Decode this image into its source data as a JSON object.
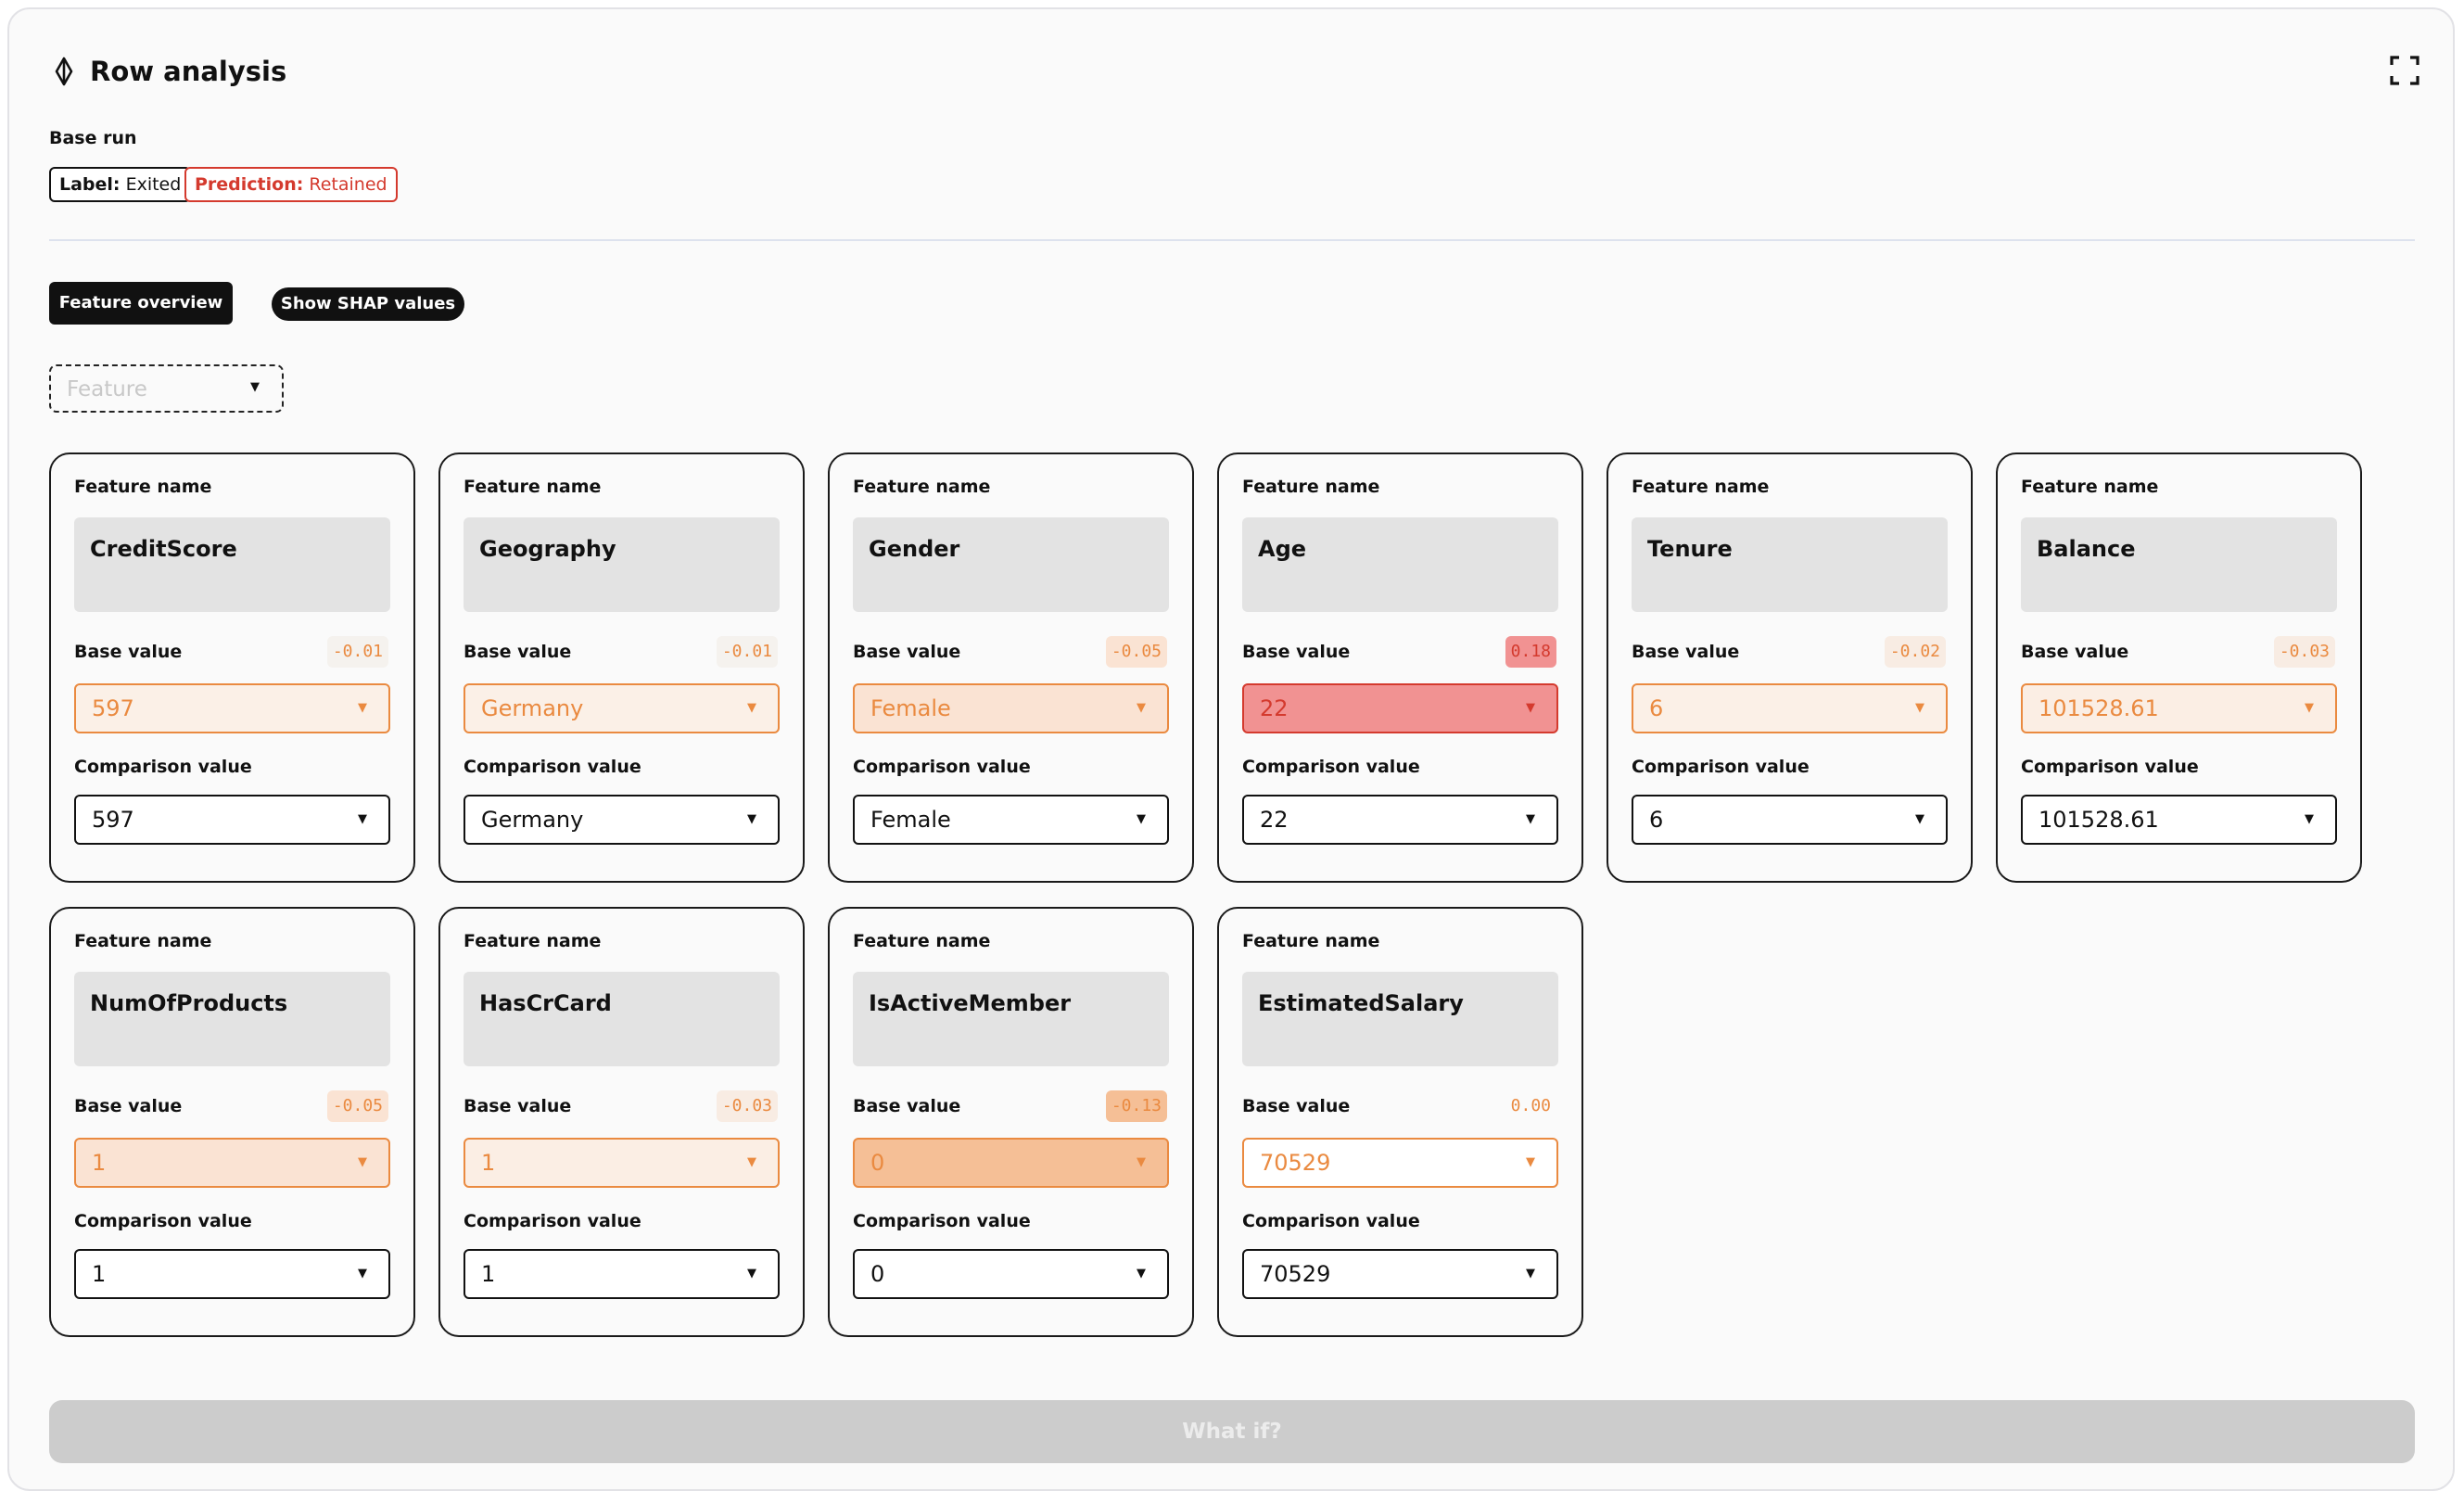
{
  "header": {
    "title": "Row analysis",
    "title_icon": "diamond-cursor-icon",
    "expand_icon": "fullscreen-icon"
  },
  "base_run": {
    "label": "Base run",
    "label_badge": {
      "key": "Label:",
      "value": "Exited"
    },
    "prediction_badge": {
      "key": "Prediction:",
      "value": "Retained"
    }
  },
  "tabs": {
    "feature_overview": "Feature overview",
    "show_shap": "Show SHAP values"
  },
  "feature_filter": {
    "placeholder": "Feature"
  },
  "labels": {
    "feature_name": "Feature name",
    "base_value": "Base value",
    "comparison_value": "Comparison value"
  },
  "cards": [
    {
      "name": "CreditScore",
      "shap": "-0.01",
      "base": "597",
      "comparison": "597",
      "shap_text": "#ea8a40",
      "shap_bg": "#f5f2ee",
      "base_bg": "#fbf0e7",
      "base_text": "#ea8a40"
    },
    {
      "name": "Geography",
      "shap": "-0.01",
      "base": "Germany",
      "comparison": "Germany",
      "shap_text": "#ea8a40",
      "shap_bg": "#f5f2ee",
      "base_bg": "#fbf0e7",
      "base_text": "#ea8a40"
    },
    {
      "name": "Gender",
      "shap": "-0.05",
      "base": "Female",
      "comparison": "Female",
      "shap_text": "#ea8a40",
      "shap_bg": "#fae3d3",
      "base_bg": "#fae3d3",
      "base_text": "#ea8a40"
    },
    {
      "name": "Age",
      "shap": "0.18",
      "base": "22",
      "comparison": "22",
      "shap_text": "#d43a2e",
      "shap_bg": "#f19292",
      "base_bg": "#f19292",
      "base_text": "#d43a2e"
    },
    {
      "name": "Tenure",
      "shap": "-0.02",
      "base": "6",
      "comparison": "6",
      "shap_text": "#ea8a40",
      "shap_bg": "#f8ece3",
      "base_bg": "#fbf0e7",
      "base_text": "#ea8a40"
    },
    {
      "name": "Balance",
      "shap": "-0.03",
      "base": "101528.61",
      "comparison": "101528.61",
      "shap_text": "#ea8a40",
      "shap_bg": "#f8ece3",
      "base_bg": "#fbeee4",
      "base_text": "#ea8a40"
    },
    {
      "name": "NumOfProducts",
      "shap": "-0.05",
      "base": "1",
      "comparison": "1",
      "shap_text": "#ea8a40",
      "shap_bg": "#fae3d3",
      "base_bg": "#fae3d3",
      "base_text": "#ea8a40"
    },
    {
      "name": "HasCrCard",
      "shap": "-0.03",
      "base": "1",
      "comparison": "1",
      "shap_text": "#ea8a40",
      "shap_bg": "#f8ece3",
      "base_bg": "#fbeee4",
      "base_text": "#ea8a40"
    },
    {
      "name": "IsActiveMember",
      "shap": "-0.13",
      "base": "0",
      "comparison": "0",
      "shap_text": "#ea8a40",
      "shap_bg": "#f5bf96",
      "base_bg": "#f5bf96",
      "base_text": "#ea8a40"
    },
    {
      "name": "EstimatedSalary",
      "shap": "0.00",
      "base": "70529",
      "comparison": "70529",
      "shap_text": "#ea8a40",
      "shap_bg": "transparent",
      "base_bg": "#ffffff",
      "base_text": "#ea8a40"
    }
  ],
  "what_if": {
    "label": "What if?"
  },
  "colors": {
    "accent_orange": "#ea8a40",
    "accent_red": "#d43a2e",
    "dark": "#111111",
    "disabled": "#cccccc"
  }
}
